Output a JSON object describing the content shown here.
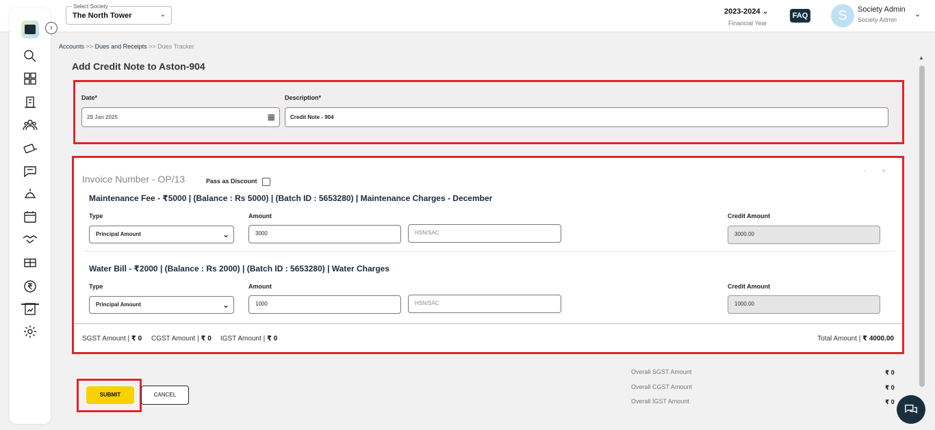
{
  "header": {
    "society_label": "Select Society",
    "society_value": "The North Tower",
    "financial_year": "2023-2024",
    "financial_year_label": "Financial Year",
    "faq": "FAQ",
    "avatar_letter": "S",
    "user_name": "Society Admin",
    "user_role": "Society Admin"
  },
  "breadcrumb": {
    "accounts": "Accounts",
    "sep1": ">>",
    "dues": "Dues and Receipts",
    "sep2": ">>",
    "current": "Dues Tracker"
  },
  "page_title": "Add Credit Note to Aston-904",
  "form": {
    "date_label": "Date*",
    "date_value": "28 Jan 2025",
    "description_label": "Description*",
    "description_value": "Credit Note - 904"
  },
  "invoice": {
    "title": "Invoice Number - OP/13",
    "pass_discount": "Pass as Discount",
    "controls": "- ×",
    "lines": [
      {
        "title": "Maintenance Fee - ₹5000 | (Balance : Rs 5000) | (Batch ID : 5653280) | Maintenance Charges - December",
        "type_label": "Type",
        "type_value": "Principal Amount",
        "amount_label": "Amount",
        "amount_value": "3000",
        "hsn_placeholder": "HSN/SAC",
        "credit_label": "Credit Amount",
        "credit_value": "3000.00"
      },
      {
        "title": "Water Bill - ₹2000 | (Balance : Rs 2000) | (Batch ID : 5653280) | Water Charges",
        "type_label": "Type",
        "type_value": "Principal Amount",
        "amount_label": "Amount",
        "amount_value": "1000",
        "hsn_placeholder": "HSN/SAC",
        "credit_label": "Credit Amount",
        "credit_value": "1000.00"
      }
    ],
    "sgst_label": "SGST Amount |",
    "sgst_value": "₹ 0",
    "cgst_label": "CGST Amount |",
    "cgst_value": "₹ 0",
    "igst_label": "IGST Amount |",
    "igst_value": "₹ 0",
    "total_label": "Total Amount |",
    "total_value": "₹ 4000.00"
  },
  "overall": {
    "sgst_label": "Overall SGST Amount",
    "sgst_value": "₹ 0",
    "cgst_label": "Overall CGST Amount",
    "cgst_value": "₹ 0",
    "igst_label": "Overall IGST Amount",
    "igst_value": "₹ 0"
  },
  "buttons": {
    "submit": "SUBMIT",
    "cancel": "CANCEL"
  },
  "sidebar": {
    "icons": [
      "search-icon",
      "dashboard-icon",
      "building-icon",
      "members-icon",
      "payments-icon",
      "chat-icon",
      "helpdesk-icon",
      "calendar-icon",
      "handshake-icon",
      "amenities-icon",
      "rupee-icon",
      "reports-icon",
      "settings-icon"
    ]
  },
  "colors": {
    "highlight": "#e0242b",
    "submit": "#f7d200",
    "dark": "#18303e"
  }
}
